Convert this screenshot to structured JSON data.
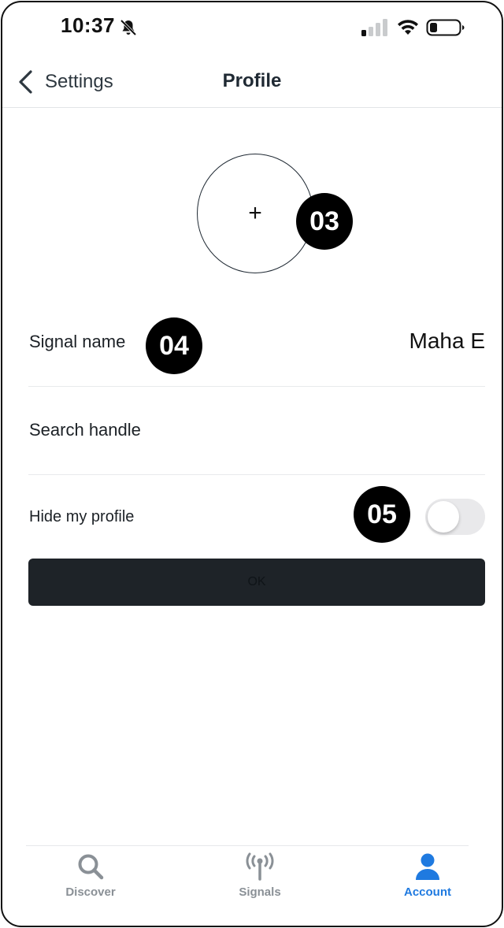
{
  "status_bar": {
    "time": "10:37",
    "icons": [
      "bell-slash-icon",
      "cellular-signal-icon",
      "wifi-icon",
      "battery-icon"
    ]
  },
  "nav": {
    "back_label": "Settings",
    "title": "Profile"
  },
  "avatar": {
    "plus": "+"
  },
  "callouts": {
    "c3": "03",
    "c4": "04",
    "c5": "05"
  },
  "profile": {
    "signal_name_label": "Signal name",
    "signal_name_value": "Maha E",
    "search_handle_label": "Search handle",
    "hide_profile_label": "Hide my profile",
    "hide_profile_on": false
  },
  "ok_button": "OK",
  "tabbar": {
    "tabs": [
      {
        "label": "Discover",
        "icon": "search-icon",
        "active": false
      },
      {
        "label": "Signals",
        "icon": "antenna-icon",
        "active": false
      },
      {
        "label": "Account",
        "icon": "person-icon",
        "active": true
      }
    ]
  },
  "colors": {
    "accent": "#1f7ae0",
    "button_bg": "#1e2328",
    "inactive_tab": "#8a9096",
    "toggle_off": "#e9e9eb"
  }
}
